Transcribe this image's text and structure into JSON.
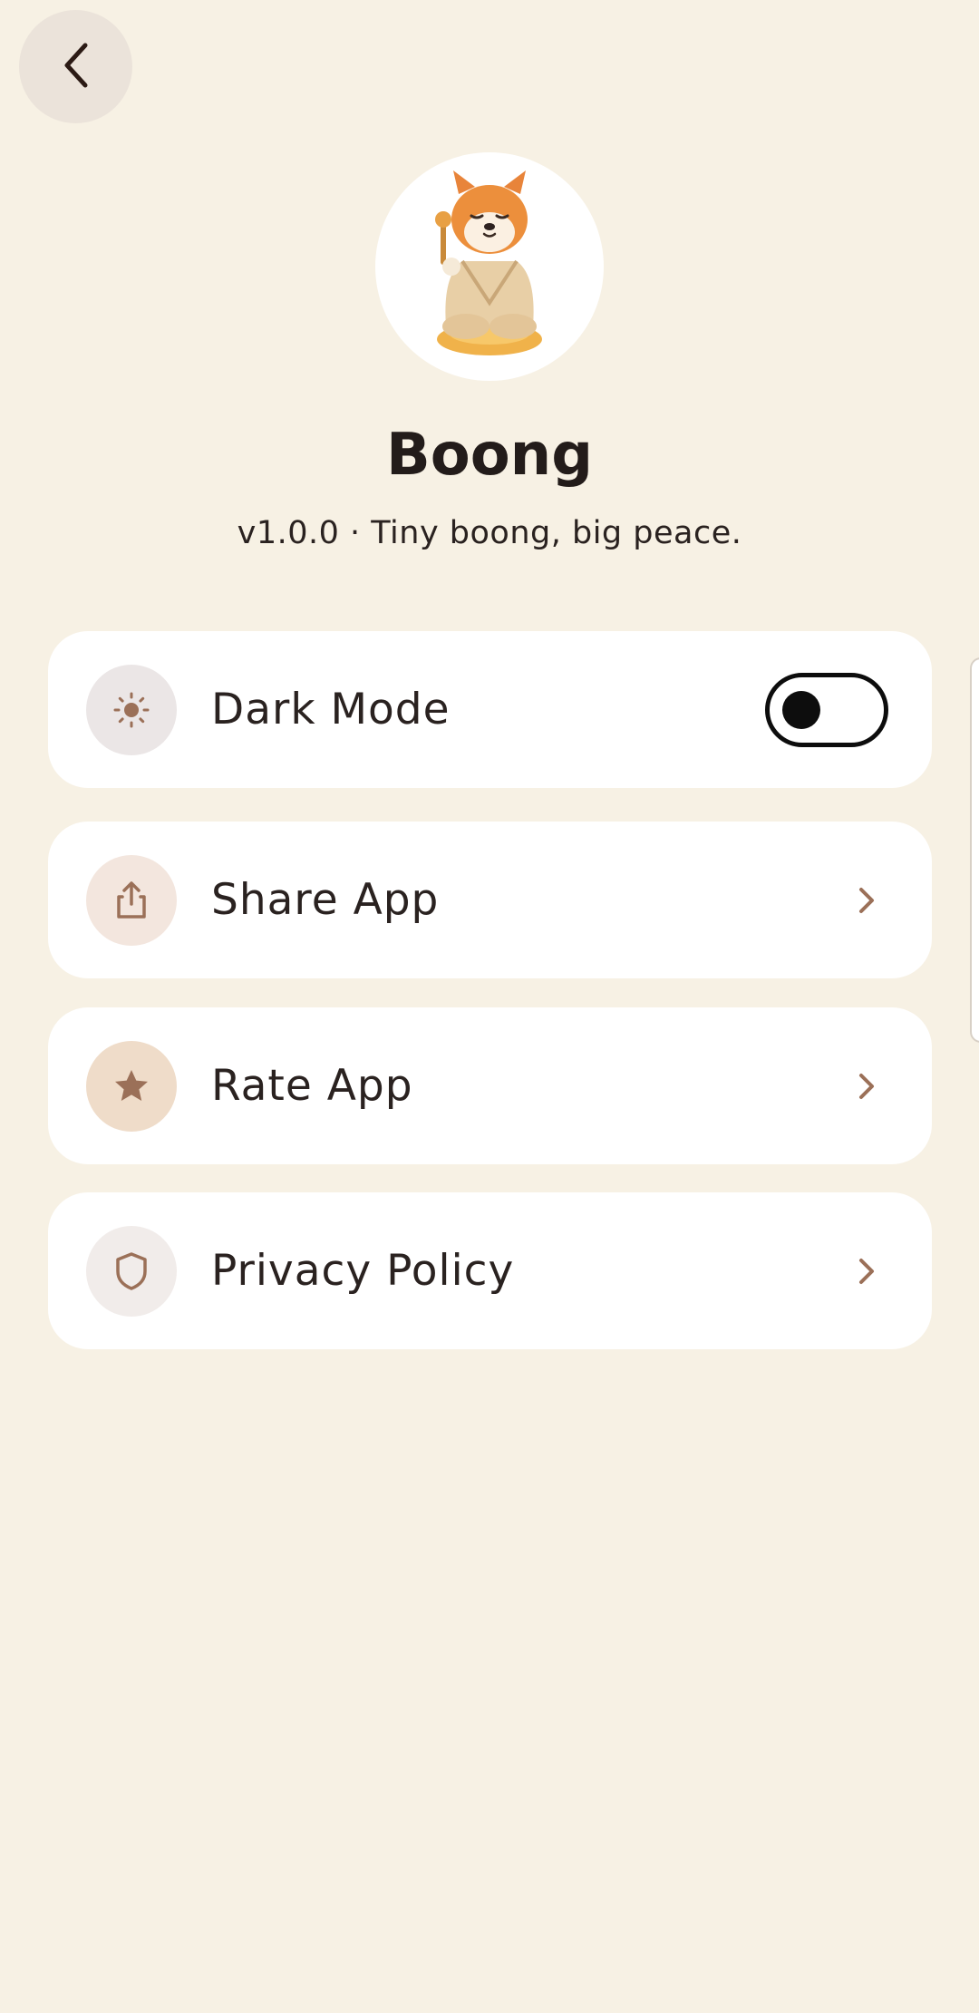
{
  "header": {
    "back_icon": "chevron-left-icon"
  },
  "profile": {
    "avatar_icon": "shiba-mascot-image",
    "name": "Boong",
    "tagline": "v1.0.0 · Tiny boong, big peace."
  },
  "settings": {
    "items": [
      {
        "label": "Dark Mode",
        "icon": "sun-icon",
        "icon_bg": "#ebe6e6",
        "control": "toggle",
        "toggle_on": false
      },
      {
        "label": "Share App",
        "icon": "share-icon",
        "icon_bg": "#f3e6de",
        "control": "chevron"
      },
      {
        "label": "Rate App",
        "icon": "star-icon",
        "icon_bg": "#efdcc9",
        "control": "chevron"
      },
      {
        "label": "Privacy Policy",
        "icon": "shield-icon",
        "icon_bg": "#f1ecea",
        "control": "chevron"
      }
    ]
  },
  "colors": {
    "background": "#f7f1e4",
    "card": "#ffffff",
    "accent_brown": "#9b7058",
    "text": "#2a2220"
  }
}
